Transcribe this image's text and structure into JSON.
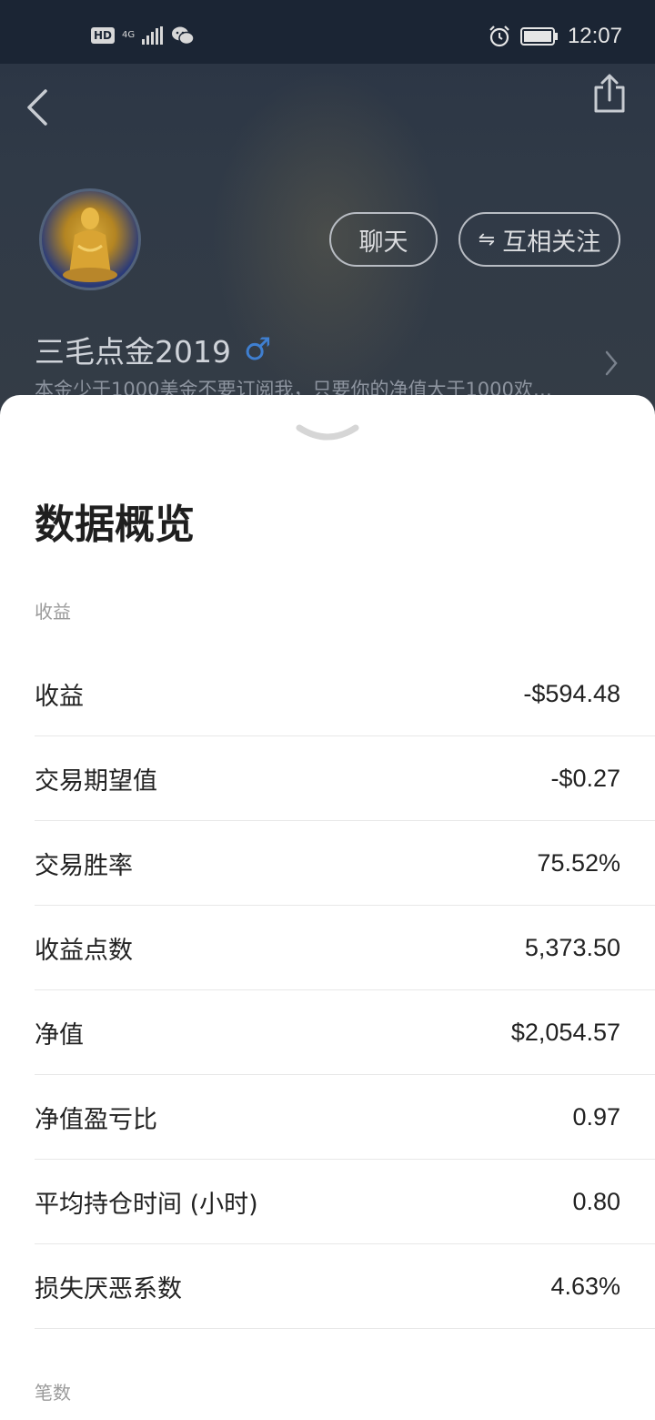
{
  "status_bar": {
    "hd": "HD",
    "network": "4G",
    "time": "12:07"
  },
  "profile": {
    "chat_label": "聊天",
    "follow_label": "互相关注",
    "username": "三毛点金2019",
    "gender_symbol": "♂",
    "bio": "本金少于1000美金不要订阅我，只要你的净值大于1000欢…"
  },
  "sheet": {
    "title": "数据概览",
    "section_income": "收益",
    "section_trades": "笔数",
    "metrics": [
      {
        "label": "收益",
        "value": "-$594.48"
      },
      {
        "label": "交易期望值",
        "value": "-$0.27"
      },
      {
        "label": "交易胜率",
        "value": "75.52%"
      },
      {
        "label": "收益点数",
        "value": "5,373.50"
      },
      {
        "label": "净值",
        "value": "$2,054.57"
      },
      {
        "label": "净值盈亏比",
        "value": "0.97"
      },
      {
        "label": "平均持仓时间 (小时)",
        "value": "0.80"
      },
      {
        "label": "损失厌恶系数",
        "value": "4.63%"
      }
    ]
  },
  "icons": {
    "back": "back-arrow-icon",
    "share": "share-icon",
    "gender": "male-icon",
    "chevron": "chevron-right-icon",
    "handle": "chevron-down-icon"
  },
  "colors": {
    "header_bg": "#303a47",
    "status_bar_bg": "#1b2534",
    "gender_blue": "#3f7fd0",
    "sheet_bg": "#ffffff"
  }
}
